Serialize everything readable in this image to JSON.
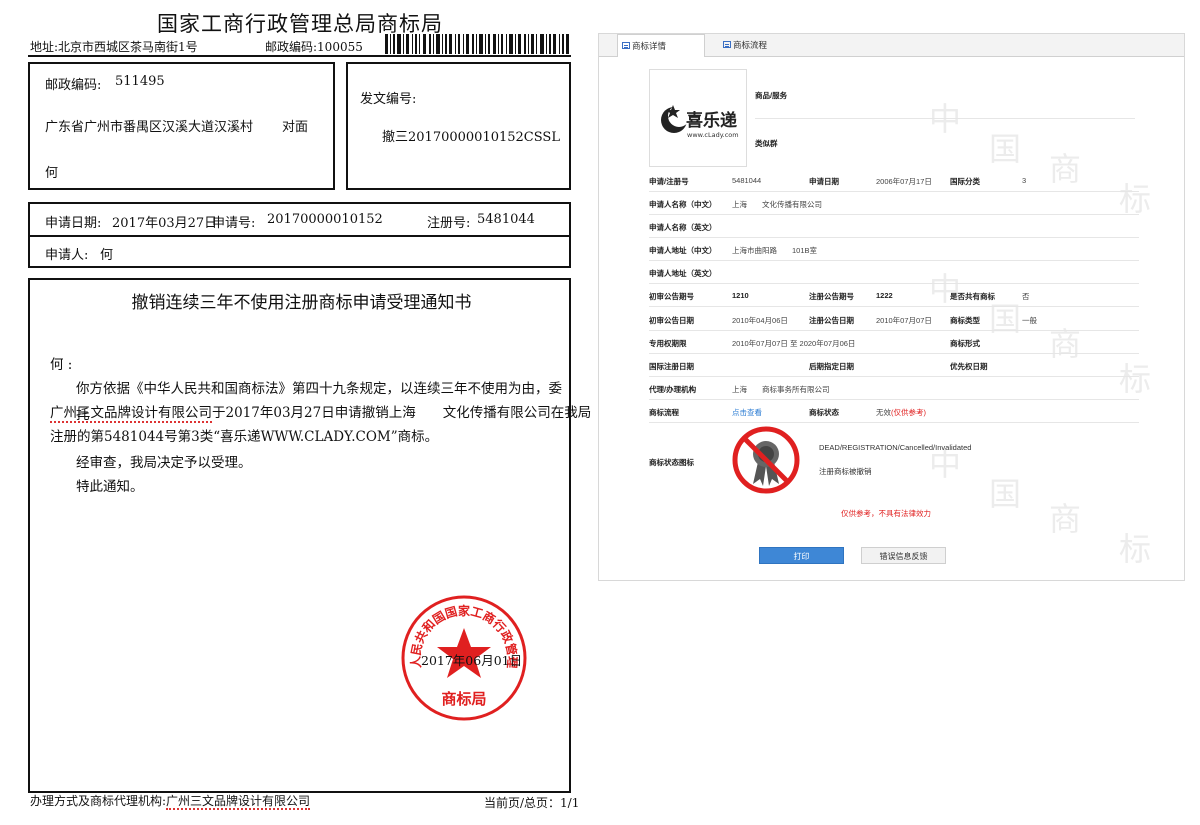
{
  "document": {
    "title": "国家工商行政管理总局商标局",
    "address": "地址:北京市西城区茶马南街1号",
    "postcode": "邮政编码:100055",
    "recipient": {
      "postcode_label": "邮政编码:",
      "postcode_value": "511495",
      "address": "广东省广州市番禺区汉溪大道汉溪村",
      "address_suffix": "对面",
      "name": "何"
    },
    "doc_no_label": "发文编号:",
    "doc_no_value": "撤三20170000010152CSSL",
    "application": {
      "date_label": "申请日期:",
      "date_value": "2017年03月27日",
      "appno_label": "申请号:",
      "appno_value": "20170000010152",
      "regno_label": "注册号:",
      "regno_value": "5481044",
      "applicant_label": "申请人:",
      "applicant_value": "何"
    },
    "notice": {
      "title": "撤销连续三年不使用注册商标申请受理通知书",
      "salutation": "何 :",
      "para1_line1": "你方依据《中华人民共和国商标法》第四十九条规定，以连续三年不使用为由，委托",
      "para1_agent": "广州三文品牌设计有限公司",
      "para1_line2_rest": "于2017年03月27日申请撤销上海　　文化传播有限公司在我局",
      "para1_line3": "注册的第5481044号第3类“喜乐递WWW.CLADY.COM”商标。",
      "para2": "经审查，我局决定予以受理。",
      "para3": "特此通知。",
      "seal_text": "中华人民共和国国家工商行政管理总局",
      "seal_bottom": "商标局",
      "sign_date": "2017年06月01日"
    },
    "footer_label": "办理方式及商标代理机构:",
    "footer_agent": "广州三文品牌设计有限公司",
    "footer_page": "当前页/总页：1/1"
  },
  "panel": {
    "tabs": [
      "商标详情",
      "商标流程"
    ],
    "watermark_chars": [
      "中",
      "国",
      "商",
      "标"
    ],
    "logo_text": "喜乐递",
    "logo_url": "www.cLady.com",
    "goods_label": "商品/服务",
    "similar_label": "类似群",
    "rows": {
      "reg_no_label": "申请/注册号",
      "reg_no_value": "5481044",
      "app_date_label": "申请日期",
      "app_date_value": "2006年07月17日",
      "class_label": "国际分类",
      "class_value": "3",
      "applicant_cn_label": "申请人名称（中文）",
      "applicant_cn_value": "上海　　文化传播有限公司",
      "applicant_en_label": "申请人名称（英文）",
      "addr_cn_label": "申请人地址（中文）",
      "addr_cn_value": "上海市曲阳路　　101B室",
      "addr_en_label": "申请人地址（英文）",
      "prelim_no_label": "初审公告期号",
      "prelim_no_value": "1210",
      "reg_pub_no_label": "注册公告期号",
      "reg_pub_no_value": "1222",
      "shared_label": "是否共有商标",
      "shared_value": "否",
      "prelim_date_label": "初审公告日期",
      "prelim_date_value": "2010年04月06日",
      "reg_pub_date_label": "注册公告日期",
      "reg_pub_date_value": "2010年07月07日",
      "tm_type_label": "商标类型",
      "tm_type_value": "一般",
      "excl_label": "专用权期限",
      "excl_value": "2010年07月07日 至 2020年07月06日",
      "tm_form_label": "商标形式",
      "intl_reg_label": "国际注册日期",
      "later_label": "后期指定日期",
      "priority_label": "优先权日期",
      "agent_label": "代理/办理机构",
      "agent_value": "上海　　商标事务所有限公司",
      "flow_label": "商标流程",
      "flow_link": "点击查看",
      "status_label": "商标状态",
      "status_value": "无效",
      "status_note": "(仅供参考)",
      "status_icon_label": "商标状态图标",
      "status_en": "DEAD/REGISTRATION/Cancelled/Invalidated",
      "status_cn": "注册商标被撤销",
      "disclaimer": "仅供参考，不具有法律效力"
    },
    "buttons": {
      "print": "打印",
      "feedback": "错误信息反馈"
    }
  },
  "colors": {
    "seal_red": "#e02020",
    "link_blue": "#2a7bd3",
    "button_blue": "#3e87d6"
  }
}
